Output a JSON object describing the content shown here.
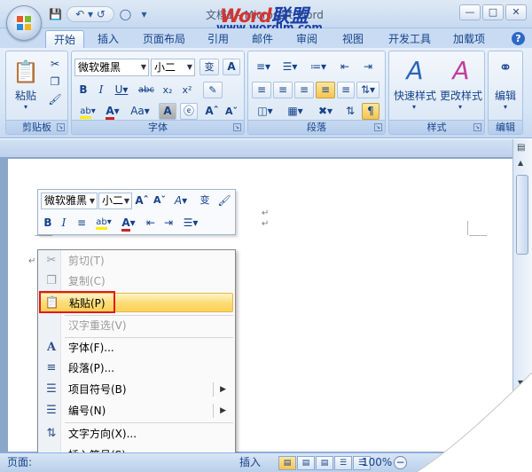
{
  "app": {
    "window_title": "文档1 - Microsoft Word",
    "watermark_part1": "Word",
    "watermark_part2": "联盟",
    "watermark_url": "www.wordlm.com",
    "help_label": "?"
  },
  "tabs": [
    {
      "label": "开始",
      "active": true
    },
    {
      "label": "插入"
    },
    {
      "label": "页面布局"
    },
    {
      "label": "引用"
    },
    {
      "label": "邮件"
    },
    {
      "label": "审阅"
    },
    {
      "label": "视图"
    },
    {
      "label": "开发工具"
    },
    {
      "label": "加载项"
    }
  ],
  "ribbon": {
    "clipboard": {
      "label": "剪贴板",
      "paste": "粘贴"
    },
    "font": {
      "label": "字体",
      "font_name": "微软雅黑",
      "font_size": "小二",
      "phonetic": "变",
      "char_border": "A"
    },
    "paragraph": {
      "label": "段落"
    },
    "styles": {
      "label": "样式",
      "quick_styles": "快速样式",
      "change_styles": "更改样式"
    },
    "editing": {
      "label": "编辑",
      "edit": "编辑"
    }
  },
  "mini_toolbar": {
    "font_name": "微软雅黑",
    "font_size": "小二",
    "phonetic": "变"
  },
  "context_menu": {
    "items": [
      {
        "label": "剪切(T)",
        "icon": "cut-icon",
        "enabled": false
      },
      {
        "label": "复制(C)",
        "icon": "copy-icon",
        "enabled": false
      },
      {
        "label": "粘贴(P)",
        "icon": "paste-icon",
        "enabled": true,
        "highlighted": true
      },
      {
        "label": "汉字重选(V)",
        "icon": "",
        "enabled": false
      },
      {
        "label": "字体(F)...",
        "icon": "font-icon",
        "enabled": true
      },
      {
        "label": "段落(P)...",
        "icon": "paragraph-icon",
        "enabled": true
      },
      {
        "label": "项目符号(B)",
        "icon": "bullets-icon",
        "enabled": true,
        "submenu": true
      },
      {
        "label": "编号(N)",
        "icon": "numbering-icon",
        "enabled": true,
        "submenu": true
      },
      {
        "label": "文字方向(X)...",
        "icon": "text-direction-icon",
        "enabled": true
      },
      {
        "label": "插入符号(S)",
        "icon": "",
        "enabled": true
      }
    ]
  },
  "statusbar": {
    "page": "页面:",
    "insert_mode": "插入",
    "zoom": "100%"
  },
  "colors": {
    "ribbon_blue": "#15428b",
    "highlight": "#fbd055",
    "red_box": "#e0191c"
  }
}
